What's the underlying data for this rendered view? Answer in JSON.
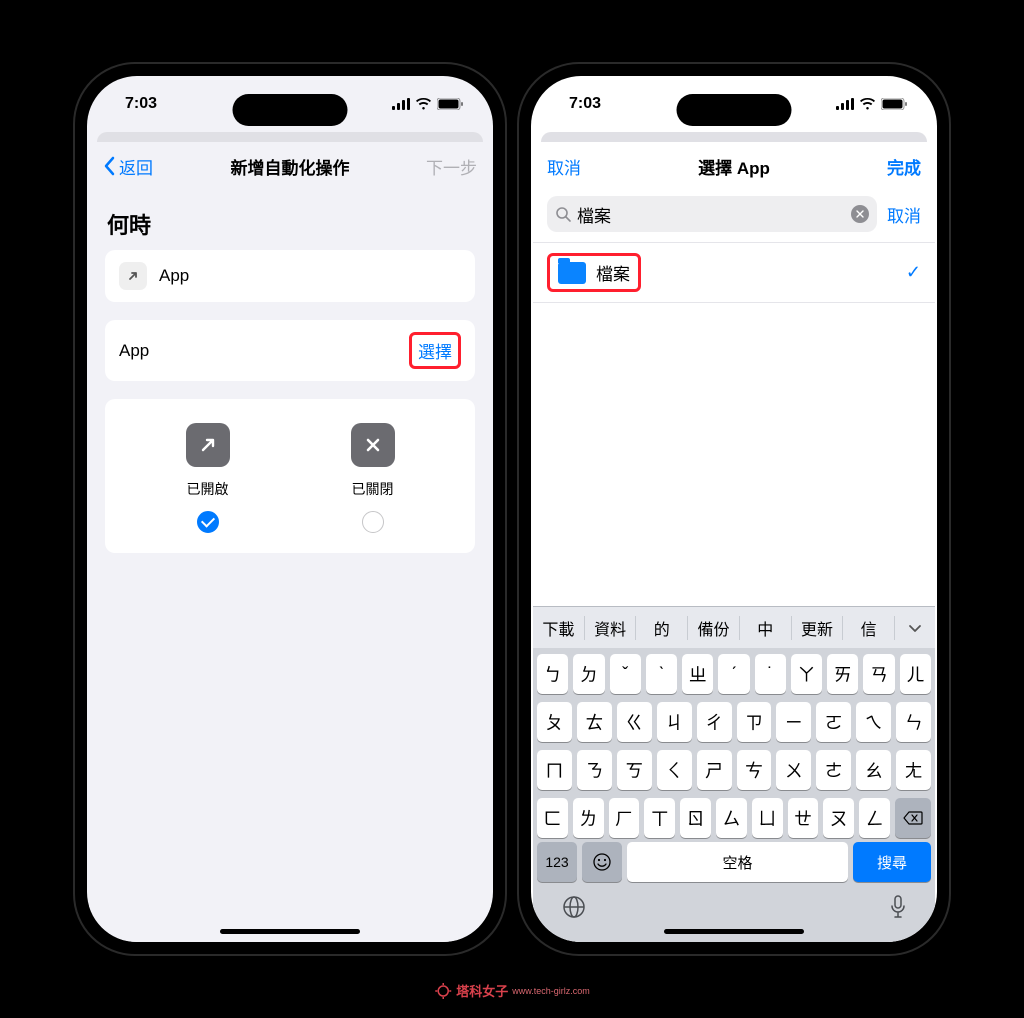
{
  "status": {
    "time": "7:03"
  },
  "phone1": {
    "nav": {
      "back": "返回",
      "title": "新增自動化操作",
      "next": "下一步"
    },
    "section_title": "何時",
    "app_row_label": "App",
    "select_row_label": "App",
    "select_button": "選擇",
    "option_open": "已開啟",
    "option_close": "已關閉"
  },
  "phone2": {
    "nav": {
      "cancel": "取消",
      "title": "選擇 App",
      "done": "完成"
    },
    "search": {
      "value": "檔案",
      "cancel": "取消"
    },
    "result": {
      "label": "檔案"
    },
    "suggestions": [
      "下載",
      "資料",
      "的",
      "備份",
      "中",
      "更新",
      "信"
    ],
    "kb_rows": [
      [
        "ㄅ",
        "ㄉ",
        "ˇ",
        "ˋ",
        "ㄓ",
        "ˊ",
        "˙",
        "ㄚ",
        "ㄞ",
        "ㄢ",
        "ㄦ"
      ],
      [
        "ㄆ",
        "ㄊ",
        "ㄍ",
        "ㄐ",
        "ㄔ",
        "ㄗ",
        "ㄧ",
        "ㄛ",
        "ㄟ",
        "ㄣ"
      ],
      [
        "ㄇ",
        "ㄋ",
        "ㄎ",
        "ㄑ",
        "ㄕ",
        "ㄘ",
        "ㄨ",
        "ㄜ",
        "ㄠ",
        "ㄤ"
      ],
      [
        "ㄈ",
        "ㄌ",
        "ㄏ",
        "ㄒ",
        "ㄖ",
        "ㄙ",
        "ㄩ",
        "ㄝ",
        "ㄡ",
        "ㄥ"
      ]
    ],
    "kb_num": "123",
    "kb_space": "空格",
    "kb_search": "搜尋"
  },
  "watermark": {
    "main": "塔科女子",
    "sub": "www.tech-girlz.com"
  }
}
